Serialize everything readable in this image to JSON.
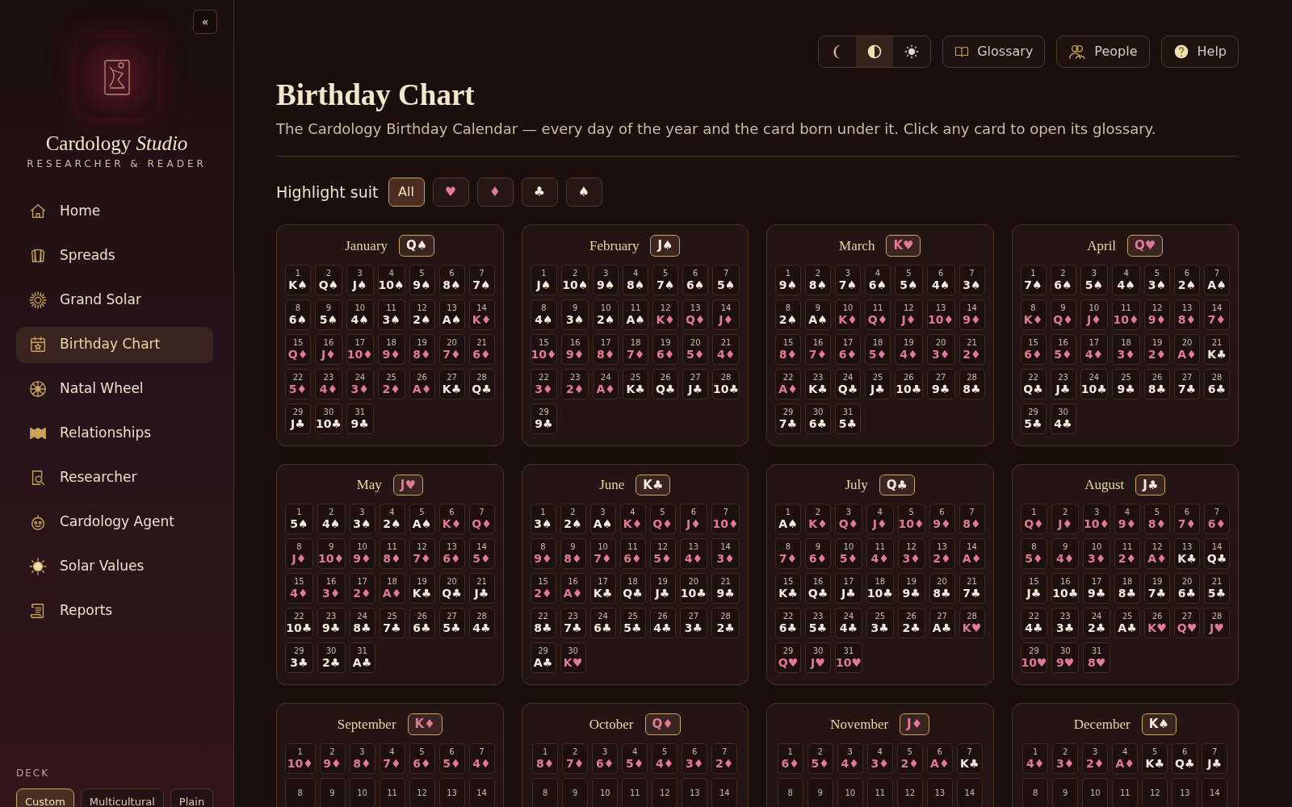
{
  "sidebar": {
    "collapse_button": "«",
    "brand": "Cardology *Studio*",
    "tagline": "RESEARCHER & READER",
    "nav": [
      {
        "label": "Home",
        "selected": false
      },
      {
        "label": "Spreads",
        "selected": false
      },
      {
        "label": "Grand Solar",
        "selected": false
      },
      {
        "label": "Birthday Chart",
        "selected": true
      },
      {
        "label": "Natal Wheel",
        "selected": false
      },
      {
        "label": "Relationships",
        "selected": false
      },
      {
        "label": "Researcher",
        "selected": false
      },
      {
        "label": "Cardology Agent",
        "selected": false
      },
      {
        "label": "Solar Values",
        "selected": false
      },
      {
        "label": "Reports",
        "selected": false
      }
    ],
    "deck_label": "DECK",
    "deck_options": [
      {
        "label": "Custom",
        "selected": true
      },
      {
        "label": "Multicultural",
        "selected": false
      },
      {
        "label": "Plain",
        "selected": false
      }
    ]
  },
  "toolbar": {
    "theme_modes": [
      {
        "kind": "dark",
        "selected": false
      },
      {
        "kind": "auto",
        "selected": true
      },
      {
        "kind": "light",
        "selected": false
      }
    ],
    "buttons": [
      {
        "label": "Glossary",
        "kind": "book"
      },
      {
        "label": "People",
        "kind": "people"
      },
      {
        "label": "Help",
        "kind": "help"
      }
    ]
  },
  "page": {
    "title": "Birthday Chart",
    "description": "The Cardology Birthday Calendar — every day of the year and the card born under it. Click any card to open its glossary.",
    "highlight_label": "Highlight suit",
    "suit_filters": [
      {
        "label": "All",
        "selected": true
      },
      {
        "label": "♥",
        "color": "#e07a96",
        "selected": false
      },
      {
        "label": "♦",
        "color": "#e07a96",
        "selected": false
      },
      {
        "label": "♣",
        "color": "#f5ebdc",
        "selected": false
      },
      {
        "label": "♠",
        "color": "#f5ebdc",
        "selected": false
      }
    ]
  },
  "months": [
    {
      "name": "January",
      "card": "Q♠",
      "color": "#f5ebdc",
      "days": [
        {
          "day": "1",
          "card": "K♠",
          "color": "#f5ebdc"
        },
        {
          "day": "2",
          "card": "Q♠",
          "color": "#f5ebdc"
        },
        {
          "day": "3",
          "card": "J♠",
          "color": "#f5ebdc"
        },
        {
          "day": "4",
          "card": "10♠",
          "color": "#f5ebdc"
        },
        {
          "day": "5",
          "card": "9♠",
          "color": "#f5ebdc"
        },
        {
          "day": "6",
          "card": "8♠",
          "color": "#f5ebdc"
        },
        {
          "day": "7",
          "card": "7♠",
          "color": "#f5ebdc"
        },
        {
          "day": "8",
          "card": "6♠",
          "color": "#f5ebdc"
        },
        {
          "day": "9",
          "card": "5♠",
          "color": "#f5ebdc"
        },
        {
          "day": "10",
          "card": "4♠",
          "color": "#f5ebdc"
        },
        {
          "day": "11",
          "card": "3♠",
          "color": "#f5ebdc"
        },
        {
          "day": "12",
          "card": "2♠",
          "color": "#f5ebdc"
        },
        {
          "day": "13",
          "card": "A♠",
          "color": "#f5ebdc"
        },
        {
          "day": "14",
          "card": "K♦",
          "color": "#e07a96"
        },
        {
          "day": "15",
          "card": "Q♦",
          "color": "#e07a96"
        },
        {
          "day": "16",
          "card": "J♦",
          "color": "#e07a96"
        },
        {
          "day": "17",
          "card": "10♦",
          "color": "#e07a96"
        },
        {
          "day": "18",
          "card": "9♦",
          "color": "#e07a96"
        },
        {
          "day": "19",
          "card": "8♦",
          "color": "#e07a96"
        },
        {
          "day": "20",
          "card": "7♦",
          "color": "#e07a96"
        },
        {
          "day": "21",
          "card": "6♦",
          "color": "#e07a96"
        },
        {
          "day": "22",
          "card": "5♦",
          "color": "#e07a96"
        },
        {
          "day": "23",
          "card": "4♦",
          "color": "#e07a96"
        },
        {
          "day": "24",
          "card": "3♦",
          "color": "#e07a96"
        },
        {
          "day": "25",
          "card": "2♦",
          "color": "#e07a96"
        },
        {
          "day": "26",
          "card": "A♦",
          "color": "#e07a96"
        },
        {
          "day": "27",
          "card": "K♣",
          "color": "#f5ebdc"
        },
        {
          "day": "28",
          "card": "Q♣",
          "color": "#f5ebdc"
        },
        {
          "day": "29",
          "card": "J♣",
          "color": "#f5ebdc"
        },
        {
          "day": "30",
          "card": "10♣",
          "color": "#f5ebdc"
        },
        {
          "day": "31",
          "card": "9♣",
          "color": "#f5ebdc"
        }
      ]
    },
    {
      "name": "February",
      "card": "J♠",
      "color": "#f5ebdc",
      "days": [
        {
          "day": "1",
          "card": "J♠",
          "color": "#f5ebdc"
        },
        {
          "day": "2",
          "card": "10♠",
          "color": "#f5ebdc"
        },
        {
          "day": "3",
          "card": "9♠",
          "color": "#f5ebdc"
        },
        {
          "day": "4",
          "card": "8♠",
          "color": "#f5ebdc"
        },
        {
          "day": "5",
          "card": "7♠",
          "color": "#f5ebdc"
        },
        {
          "day": "6",
          "card": "6♠",
          "color": "#f5ebdc"
        },
        {
          "day": "7",
          "card": "5♠",
          "color": "#f5ebdc"
        },
        {
          "day": "8",
          "card": "4♠",
          "color": "#f5ebdc"
        },
        {
          "day": "9",
          "card": "3♠",
          "color": "#f5ebdc"
        },
        {
          "day": "10",
          "card": "2♠",
          "color": "#f5ebdc"
        },
        {
          "day": "11",
          "card": "A♠",
          "color": "#f5ebdc"
        },
        {
          "day": "12",
          "card": "K♦",
          "color": "#e07a96"
        },
        {
          "day": "13",
          "card": "Q♦",
          "color": "#e07a96"
        },
        {
          "day": "14",
          "card": "J♦",
          "color": "#e07a96"
        },
        {
          "day": "15",
          "card": "10♦",
          "color": "#e07a96"
        },
        {
          "day": "16",
          "card": "9♦",
          "color": "#e07a96"
        },
        {
          "day": "17",
          "card": "8♦",
          "color": "#e07a96"
        },
        {
          "day": "18",
          "card": "7♦",
          "color": "#e07a96"
        },
        {
          "day": "19",
          "card": "6♦",
          "color": "#e07a96"
        },
        {
          "day": "20",
          "card": "5♦",
          "color": "#e07a96"
        },
        {
          "day": "21",
          "card": "4♦",
          "color": "#e07a96"
        },
        {
          "day": "22",
          "card": "3♦",
          "color": "#e07a96"
        },
        {
          "day": "23",
          "card": "2♦",
          "color": "#e07a96"
        },
        {
          "day": "24",
          "card": "A♦",
          "color": "#e07a96"
        },
        {
          "day": "25",
          "card": "K♣",
          "color": "#f5ebdc"
        },
        {
          "day": "26",
          "card": "Q♣",
          "color": "#f5ebdc"
        },
        {
          "day": "27",
          "card": "J♣",
          "color": "#f5ebdc"
        },
        {
          "day": "28",
          "card": "10♣",
          "color": "#f5ebdc"
        },
        {
          "day": "29",
          "card": "9♣",
          "color": "#f5ebdc"
        }
      ]
    },
    {
      "name": "March",
      "card": "K♥",
      "color": "#e07a96",
      "days": [
        {
          "day": "1",
          "card": "9♠",
          "color": "#f5ebdc"
        },
        {
          "day": "2",
          "card": "8♠",
          "color": "#f5ebdc"
        },
        {
          "day": "3",
          "card": "7♠",
          "color": "#f5ebdc"
        },
        {
          "day": "4",
          "card": "6♠",
          "color": "#f5ebdc"
        },
        {
          "day": "5",
          "card": "5♠",
          "color": "#f5ebdc"
        },
        {
          "day": "6",
          "card": "4♠",
          "color": "#f5ebdc"
        },
        {
          "day": "7",
          "card": "3♠",
          "color": "#f5ebdc"
        },
        {
          "day": "8",
          "card": "2♠",
          "color": "#f5ebdc"
        },
        {
          "day": "9",
          "card": "A♠",
          "color": "#f5ebdc"
        },
        {
          "day": "10",
          "card": "K♦",
          "color": "#e07a96"
        },
        {
          "day": "11",
          "card": "Q♦",
          "color": "#e07a96"
        },
        {
          "day": "12",
          "card": "J♦",
          "color": "#e07a96"
        },
        {
          "day": "13",
          "card": "10♦",
          "color": "#e07a96"
        },
        {
          "day": "14",
          "card": "9♦",
          "color": "#e07a96"
        },
        {
          "day": "15",
          "card": "8♦",
          "color": "#e07a96"
        },
        {
          "day": "16",
          "card": "7♦",
          "color": "#e07a96"
        },
        {
          "day": "17",
          "card": "6♦",
          "color": "#e07a96"
        },
        {
          "day": "18",
          "card": "5♦",
          "color": "#e07a96"
        },
        {
          "day": "19",
          "card": "4♦",
          "color": "#e07a96"
        },
        {
          "day": "20",
          "card": "3♦",
          "color": "#e07a96"
        },
        {
          "day": "21",
          "card": "2♦",
          "color": "#e07a96"
        },
        {
          "day": "22",
          "card": "A♦",
          "color": "#e07a96"
        },
        {
          "day": "23",
          "card": "K♣",
          "color": "#f5ebdc"
        },
        {
          "day": "24",
          "card": "Q♣",
          "color": "#f5ebdc"
        },
        {
          "day": "25",
          "card": "J♣",
          "color": "#f5ebdc"
        },
        {
          "day": "26",
          "card": "10♣",
          "color": "#f5ebdc"
        },
        {
          "day": "27",
          "card": "9♣",
          "color": "#f5ebdc"
        },
        {
          "day": "28",
          "card": "8♣",
          "color": "#f5ebdc"
        },
        {
          "day": "29",
          "card": "7♣",
          "color": "#f5ebdc"
        },
        {
          "day": "30",
          "card": "6♣",
          "color": "#f5ebdc"
        },
        {
          "day": "31",
          "card": "5♣",
          "color": "#f5ebdc"
        }
      ]
    },
    {
      "name": "April",
      "card": "Q♥",
      "color": "#e07a96",
      "days": [
        {
          "day": "1",
          "card": "7♠",
          "color": "#f5ebdc"
        },
        {
          "day": "2",
          "card": "6♠",
          "color": "#f5ebdc"
        },
        {
          "day": "3",
          "card": "5♠",
          "color": "#f5ebdc"
        },
        {
          "day": "4",
          "card": "4♠",
          "color": "#f5ebdc"
        },
        {
          "day": "5",
          "card": "3♠",
          "color": "#f5ebdc"
        },
        {
          "day": "6",
          "card": "2♠",
          "color": "#f5ebdc"
        },
        {
          "day": "7",
          "card": "A♠",
          "color": "#f5ebdc"
        },
        {
          "day": "8",
          "card": "K♦",
          "color": "#e07a96"
        },
        {
          "day": "9",
          "card": "Q♦",
          "color": "#e07a96"
        },
        {
          "day": "10",
          "card": "J♦",
          "color": "#e07a96"
        },
        {
          "day": "11",
          "card": "10♦",
          "color": "#e07a96"
        },
        {
          "day": "12",
          "card": "9♦",
          "color": "#e07a96"
        },
        {
          "day": "13",
          "card": "8♦",
          "color": "#e07a96"
        },
        {
          "day": "14",
          "card": "7♦",
          "color": "#e07a96"
        },
        {
          "day": "15",
          "card": "6♦",
          "color": "#e07a96"
        },
        {
          "day": "16",
          "card": "5♦",
          "color": "#e07a96"
        },
        {
          "day": "17",
          "card": "4♦",
          "color": "#e07a96"
        },
        {
          "day": "18",
          "card": "3♦",
          "color": "#e07a96"
        },
        {
          "day": "19",
          "card": "2♦",
          "color": "#e07a96"
        },
        {
          "day": "20",
          "card": "A♦",
          "color": "#e07a96"
        },
        {
          "day": "21",
          "card": "K♣",
          "color": "#f5ebdc"
        },
        {
          "day": "22",
          "card": "Q♣",
          "color": "#f5ebdc"
        },
        {
          "day": "23",
          "card": "J♣",
          "color": "#f5ebdc"
        },
        {
          "day": "24",
          "card": "10♣",
          "color": "#f5ebdc"
        },
        {
          "day": "25",
          "card": "9♣",
          "color": "#f5ebdc"
        },
        {
          "day": "26",
          "card": "8♣",
          "color": "#f5ebdc"
        },
        {
          "day": "27",
          "card": "7♣",
          "color": "#f5ebdc"
        },
        {
          "day": "28",
          "card": "6♣",
          "color": "#f5ebdc"
        },
        {
          "day": "29",
          "card": "5♣",
          "color": "#f5ebdc"
        },
        {
          "day": "30",
          "card": "4♣",
          "color": "#f5ebdc"
        }
      ]
    },
    {
      "name": "May",
      "card": "J♥",
      "color": "#e07a96",
      "days": [
        {
          "day": "1",
          "card": "5♠",
          "color": "#f5ebdc"
        },
        {
          "day": "2",
          "card": "4♠",
          "color": "#f5ebdc"
        },
        {
          "day": "3",
          "card": "3♠",
          "color": "#f5ebdc"
        },
        {
          "day": "4",
          "card": "2♠",
          "color": "#f5ebdc"
        },
        {
          "day": "5",
          "card": "A♠",
          "color": "#f5ebdc"
        },
        {
          "day": "6",
          "card": "K♦",
          "color": "#e07a96"
        },
        {
          "day": "7",
          "card": "Q♦",
          "color": "#e07a96"
        },
        {
          "day": "8",
          "card": "J♦",
          "color": "#e07a96"
        },
        {
          "day": "9",
          "card": "10♦",
          "color": "#e07a96"
        },
        {
          "day": "10",
          "card": "9♦",
          "color": "#e07a96"
        },
        {
          "day": "11",
          "card": "8♦",
          "color": "#e07a96"
        },
        {
          "day": "12",
          "card": "7♦",
          "color": "#e07a96"
        },
        {
          "day": "13",
          "card": "6♦",
          "color": "#e07a96"
        },
        {
          "day": "14",
          "card": "5♦",
          "color": "#e07a96"
        },
        {
          "day": "15",
          "card": "4♦",
          "color": "#e07a96"
        },
        {
          "day": "16",
          "card": "3♦",
          "color": "#e07a96"
        },
        {
          "day": "17",
          "card": "2♦",
          "color": "#e07a96"
        },
        {
          "day": "18",
          "card": "A♦",
          "color": "#e07a96"
        },
        {
          "day": "19",
          "card": "K♣",
          "color": "#f5ebdc"
        },
        {
          "day": "20",
          "card": "Q♣",
          "color": "#f5ebdc"
        },
        {
          "day": "21",
          "card": "J♣",
          "color": "#f5ebdc"
        },
        {
          "day": "22",
          "card": "10♣",
          "color": "#f5ebdc"
        },
        {
          "day": "23",
          "card": "9♣",
          "color": "#f5ebdc"
        },
        {
          "day": "24",
          "card": "8♣",
          "color": "#f5ebdc"
        },
        {
          "day": "25",
          "card": "7♣",
          "color": "#f5ebdc"
        },
        {
          "day": "26",
          "card": "6♣",
          "color": "#f5ebdc"
        },
        {
          "day": "27",
          "card": "5♣",
          "color": "#f5ebdc"
        },
        {
          "day": "28",
          "card": "4♣",
          "color": "#f5ebdc"
        },
        {
          "day": "29",
          "card": "3♣",
          "color": "#f5ebdc"
        },
        {
          "day": "30",
          "card": "2♣",
          "color": "#f5ebdc"
        },
        {
          "day": "31",
          "card": "A♣",
          "color": "#f5ebdc"
        }
      ]
    },
    {
      "name": "June",
      "card": "K♣",
      "color": "#f5ebdc",
      "days": [
        {
          "day": "1",
          "card": "3♠",
          "color": "#f5ebdc"
        },
        {
          "day": "2",
          "card": "2♠",
          "color": "#f5ebdc"
        },
        {
          "day": "3",
          "card": "A♠",
          "color": "#f5ebdc"
        },
        {
          "day": "4",
          "card": "K♦",
          "color": "#e07a96"
        },
        {
          "day": "5",
          "card": "Q♦",
          "color": "#e07a96"
        },
        {
          "day": "6",
          "card": "J♦",
          "color": "#e07a96"
        },
        {
          "day": "7",
          "card": "10♦",
          "color": "#e07a96"
        },
        {
          "day": "8",
          "card": "9♦",
          "color": "#e07a96"
        },
        {
          "day": "9",
          "card": "8♦",
          "color": "#e07a96"
        },
        {
          "day": "10",
          "card": "7♦",
          "color": "#e07a96"
        },
        {
          "day": "11",
          "card": "6♦",
          "color": "#e07a96"
        },
        {
          "day": "12",
          "card": "5♦",
          "color": "#e07a96"
        },
        {
          "day": "13",
          "card": "4♦",
          "color": "#e07a96"
        },
        {
          "day": "14",
          "card": "3♦",
          "color": "#e07a96"
        },
        {
          "day": "15",
          "card": "2♦",
          "color": "#e07a96"
        },
        {
          "day": "16",
          "card": "A♦",
          "color": "#e07a96"
        },
        {
          "day": "17",
          "card": "K♣",
          "color": "#f5ebdc"
        },
        {
          "day": "18",
          "card": "Q♣",
          "color": "#f5ebdc"
        },
        {
          "day": "19",
          "card": "J♣",
          "color": "#f5ebdc"
        },
        {
          "day": "20",
          "card": "10♣",
          "color": "#f5ebdc"
        },
        {
          "day": "21",
          "card": "9♣",
          "color": "#f5ebdc"
        },
        {
          "day": "22",
          "card": "8♣",
          "color": "#f5ebdc"
        },
        {
          "day": "23",
          "card": "7♣",
          "color": "#f5ebdc"
        },
        {
          "day": "24",
          "card": "6♣",
          "color": "#f5ebdc"
        },
        {
          "day": "25",
          "card": "5♣",
          "color": "#f5ebdc"
        },
        {
          "day": "26",
          "card": "4♣",
          "color": "#f5ebdc"
        },
        {
          "day": "27",
          "card": "3♣",
          "color": "#f5ebdc"
        },
        {
          "day": "28",
          "card": "2♣",
          "color": "#f5ebdc"
        },
        {
          "day": "29",
          "card": "A♣",
          "color": "#f5ebdc"
        },
        {
          "day": "30",
          "card": "K♥",
          "color": "#e07a96"
        }
      ]
    },
    {
      "name": "July",
      "card": "Q♣",
      "color": "#f5ebdc",
      "days": [
        {
          "day": "1",
          "card": "A♠",
          "color": "#f5ebdc"
        },
        {
          "day": "2",
          "card": "K♦",
          "color": "#e07a96"
        },
        {
          "day": "3",
          "card": "Q♦",
          "color": "#e07a96"
        },
        {
          "day": "4",
          "card": "J♦",
          "color": "#e07a96"
        },
        {
          "day": "5",
          "card": "10♦",
          "color": "#e07a96"
        },
        {
          "day": "6",
          "card": "9♦",
          "color": "#e07a96"
        },
        {
          "day": "7",
          "card": "8♦",
          "color": "#e07a96"
        },
        {
          "day": "8",
          "card": "7♦",
          "color": "#e07a96"
        },
        {
          "day": "9",
          "card": "6♦",
          "color": "#e07a96"
        },
        {
          "day": "10",
          "card": "5♦",
          "color": "#e07a96"
        },
        {
          "day": "11",
          "card": "4♦",
          "color": "#e07a96"
        },
        {
          "day": "12",
          "card": "3♦",
          "color": "#e07a96"
        },
        {
          "day": "13",
          "card": "2♦",
          "color": "#e07a96"
        },
        {
          "day": "14",
          "card": "A♦",
          "color": "#e07a96"
        },
        {
          "day": "15",
          "card": "K♣",
          "color": "#f5ebdc"
        },
        {
          "day": "16",
          "card": "Q♣",
          "color": "#f5ebdc"
        },
        {
          "day": "17",
          "card": "J♣",
          "color": "#f5ebdc"
        },
        {
          "day": "18",
          "card": "10♣",
          "color": "#f5ebdc"
        },
        {
          "day": "19",
          "card": "9♣",
          "color": "#f5ebdc"
        },
        {
          "day": "20",
          "card": "8♣",
          "color": "#f5ebdc"
        },
        {
          "day": "21",
          "card": "7♣",
          "color": "#f5ebdc"
        },
        {
          "day": "22",
          "card": "6♣",
          "color": "#f5ebdc"
        },
        {
          "day": "23",
          "card": "5♣",
          "color": "#f5ebdc"
        },
        {
          "day": "24",
          "card": "4♣",
          "color": "#f5ebdc"
        },
        {
          "day": "25",
          "card": "3♣",
          "color": "#f5ebdc"
        },
        {
          "day": "26",
          "card": "2♣",
          "color": "#f5ebdc"
        },
        {
          "day": "27",
          "card": "A♣",
          "color": "#f5ebdc"
        },
        {
          "day": "28",
          "card": "K♥",
          "color": "#e07a96"
        },
        {
          "day": "29",
          "card": "Q♥",
          "color": "#e07a96"
        },
        {
          "day": "30",
          "card": "J♥",
          "color": "#e07a96"
        },
        {
          "day": "31",
          "card": "10♥",
          "color": "#e07a96"
        }
      ]
    },
    {
      "name": "August",
      "card": "J♣",
      "color": "#f5ebdc",
      "days": [
        {
          "day": "1",
          "card": "Q♦",
          "color": "#e07a96"
        },
        {
          "day": "2",
          "card": "J♦",
          "color": "#e07a96"
        },
        {
          "day": "3",
          "card": "10♦",
          "color": "#e07a96"
        },
        {
          "day": "4",
          "card": "9♦",
          "color": "#e07a96"
        },
        {
          "day": "5",
          "card": "8♦",
          "color": "#e07a96"
        },
        {
          "day": "6",
          "card": "7♦",
          "color": "#e07a96"
        },
        {
          "day": "7",
          "card": "6♦",
          "color": "#e07a96"
        },
        {
          "day": "8",
          "card": "5♦",
          "color": "#e07a96"
        },
        {
          "day": "9",
          "card": "4♦",
          "color": "#e07a96"
        },
        {
          "day": "10",
          "card": "3♦",
          "color": "#e07a96"
        },
        {
          "day": "11",
          "card": "2♦",
          "color": "#e07a96"
        },
        {
          "day": "12",
          "card": "A♦",
          "color": "#e07a96"
        },
        {
          "day": "13",
          "card": "K♣",
          "color": "#f5ebdc"
        },
        {
          "day": "14",
          "card": "Q♣",
          "color": "#f5ebdc"
        },
        {
          "day": "15",
          "card": "J♣",
          "color": "#f5ebdc"
        },
        {
          "day": "16",
          "card": "10♣",
          "color": "#f5ebdc"
        },
        {
          "day": "17",
          "card": "9♣",
          "color": "#f5ebdc"
        },
        {
          "day": "18",
          "card": "8♣",
          "color": "#f5ebdc"
        },
        {
          "day": "19",
          "card": "7♣",
          "color": "#f5ebdc"
        },
        {
          "day": "20",
          "card": "6♣",
          "color": "#f5ebdc"
        },
        {
          "day": "21",
          "card": "5♣",
          "color": "#f5ebdc"
        },
        {
          "day": "22",
          "card": "4♣",
          "color": "#f5ebdc"
        },
        {
          "day": "23",
          "card": "3♣",
          "color": "#f5ebdc"
        },
        {
          "day": "24",
          "card": "2♣",
          "color": "#f5ebdc"
        },
        {
          "day": "25",
          "card": "A♣",
          "color": "#f5ebdc"
        },
        {
          "day": "26",
          "card": "K♥",
          "color": "#e07a96"
        },
        {
          "day": "27",
          "card": "Q♥",
          "color": "#e07a96"
        },
        {
          "day": "28",
          "card": "J♥",
          "color": "#e07a96"
        },
        {
          "day": "29",
          "card": "10♥",
          "color": "#e07a96"
        },
        {
          "day": "30",
          "card": "9♥",
          "color": "#e07a96"
        },
        {
          "day": "31",
          "card": "8♥",
          "color": "#e07a96"
        }
      ]
    },
    {
      "name": "September",
      "card": "K♦",
      "color": "#e07a96",
      "days": [
        {
          "day": "1",
          "card": "10♦",
          "color": "#e07a96"
        },
        {
          "day": "2",
          "card": "9♦",
          "color": "#e07a96"
        },
        {
          "day": "3",
          "card": "8♦",
          "color": "#e07a96"
        },
        {
          "day": "4",
          "card": "7♦",
          "color": "#e07a96"
        },
        {
          "day": "5",
          "card": "6♦",
          "color": "#e07a96"
        },
        {
          "day": "6",
          "card": "5♦",
          "color": "#e07a96"
        },
        {
          "day": "7",
          "card": "4♦",
          "color": "#e07a96"
        },
        {
          "day": "8"
        },
        {
          "day": "9"
        },
        {
          "day": "10"
        },
        {
          "day": "11"
        },
        {
          "day": "12"
        },
        {
          "day": "13"
        },
        {
          "day": "14"
        }
      ]
    },
    {
      "name": "October",
      "card": "Q♦",
      "color": "#e07a96",
      "days": [
        {
          "day": "1",
          "card": "8♦",
          "color": "#e07a96"
        },
        {
          "day": "2",
          "card": "7♦",
          "color": "#e07a96"
        },
        {
          "day": "3",
          "card": "6♦",
          "color": "#e07a96"
        },
        {
          "day": "4",
          "card": "5♦",
          "color": "#e07a96"
        },
        {
          "day": "5",
          "card": "4♦",
          "color": "#e07a96"
        },
        {
          "day": "6",
          "card": "3♦",
          "color": "#e07a96"
        },
        {
          "day": "7",
          "card": "2♦",
          "color": "#e07a96"
        },
        {
          "day": "8"
        },
        {
          "day": "9"
        },
        {
          "day": "10"
        },
        {
          "day": "11"
        },
        {
          "day": "12"
        },
        {
          "day": "13"
        },
        {
          "day": "14"
        }
      ]
    },
    {
      "name": "November",
      "card": "J♦",
      "color": "#e07a96",
      "days": [
        {
          "day": "1",
          "card": "6♦",
          "color": "#e07a96"
        },
        {
          "day": "2",
          "card": "5♦",
          "color": "#e07a96"
        },
        {
          "day": "3",
          "card": "4♦",
          "color": "#e07a96"
        },
        {
          "day": "4",
          "card": "3♦",
          "color": "#e07a96"
        },
        {
          "day": "5",
          "card": "2♦",
          "color": "#e07a96"
        },
        {
          "day": "6",
          "card": "A♦",
          "color": "#e07a96"
        },
        {
          "day": "7",
          "card": "K♣",
          "color": "#f5ebdc"
        },
        {
          "day": "8"
        },
        {
          "day": "9"
        },
        {
          "day": "10"
        },
        {
          "day": "11"
        },
        {
          "day": "12"
        },
        {
          "day": "13"
        },
        {
          "day": "14"
        }
      ]
    },
    {
      "name": "December",
      "card": "K♠",
      "color": "#f5ebdc",
      "days": [
        {
          "day": "1",
          "card": "4♦",
          "color": "#e07a96"
        },
        {
          "day": "2",
          "card": "3♦",
          "color": "#e07a96"
        },
        {
          "day": "3",
          "card": "2♦",
          "color": "#e07a96"
        },
        {
          "day": "4",
          "card": "A♦",
          "color": "#e07a96"
        },
        {
          "day": "5",
          "card": "K♣",
          "color": "#f5ebdc"
        },
        {
          "day": "6",
          "card": "Q♣",
          "color": "#f5ebdc"
        },
        {
          "day": "7",
          "card": "J♣",
          "color": "#f5ebdc"
        },
        {
          "day": "8"
        },
        {
          "day": "9"
        },
        {
          "day": "10"
        },
        {
          "day": "11"
        },
        {
          "day": "12"
        },
        {
          "day": "13"
        },
        {
          "day": "14"
        }
      ]
    }
  ]
}
